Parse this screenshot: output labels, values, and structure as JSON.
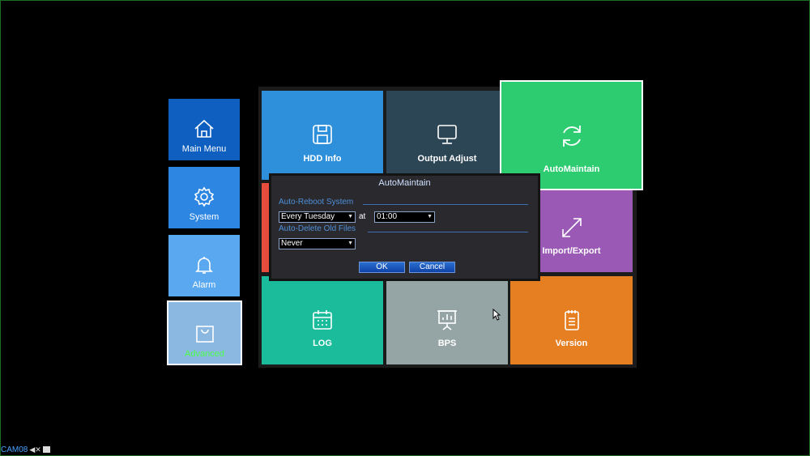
{
  "sidebar": {
    "items": [
      {
        "label": "Main Menu",
        "icon": "home-icon",
        "color": "#0f5fc0"
      },
      {
        "label": "System",
        "icon": "gear-icon",
        "color": "#2d86e2"
      },
      {
        "label": "Alarm",
        "icon": "bell-icon",
        "color": "#5aa8f0"
      },
      {
        "label": "Advanced",
        "icon": "shopping-bag-icon",
        "color": "#8bb8e0",
        "selected": true,
        "label_color": "#4cff4c"
      }
    ]
  },
  "tiles": [
    {
      "label": "HDD Info",
      "icon": "floppy-disk-icon",
      "color": "#2e8fdb"
    },
    {
      "label": "Output Adjust",
      "icon": "monitor-icon",
      "color": "#2d4655"
    },
    {
      "label": "AutoMaintain",
      "icon": "refresh-icon",
      "color": "#2ecc71"
    },
    {
      "label": "Import/Export",
      "icon": "expand-arrows-icon",
      "color": "#9b59b6"
    },
    {
      "label": "LOG",
      "icon": "calendar-icon",
      "color": "#1abc9c"
    },
    {
      "label": "BPS",
      "icon": "presentation-chart-icon",
      "color": "#95a5a6"
    },
    {
      "label": "Version",
      "icon": "document-icon",
      "color": "#e67e22"
    }
  ],
  "dialog": {
    "title": "AutoMaintain",
    "reboot_section": "Auto-Reboot System",
    "reboot_day": "Every Tuesday",
    "at_label": "at",
    "reboot_time": "01:00",
    "delete_section": "Auto-Delete Old Files",
    "delete_value": "Never",
    "ok_label": "OK",
    "cancel_label": "Cancel"
  },
  "status": {
    "camera": "CAM08"
  }
}
